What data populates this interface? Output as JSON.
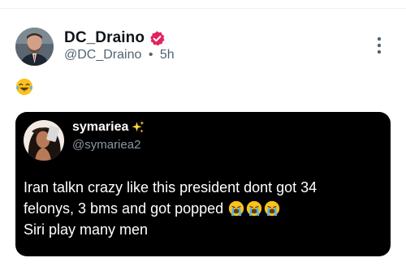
{
  "post": {
    "author_name": "DC_Draino",
    "author_handle": "@DC_Draino",
    "separator": "•",
    "time": "5h",
    "emoji": "laughing-crying-emoji"
  },
  "quote": {
    "author_name": "symariea",
    "author_handle": "@symariea2",
    "line1": "Iran talkn crazy like this president dont got 34",
    "line2": "felonys, 3 bms and got popped",
    "line3": "Siri play many men",
    "line2_emojis": [
      "loudly-crying-emoji",
      "loudly-crying-emoji",
      "loudly-crying-emoji"
    ]
  },
  "colors": {
    "verified_badge": "#e0245e",
    "handle_gray": "#536471",
    "quote_bg": "#000000"
  }
}
